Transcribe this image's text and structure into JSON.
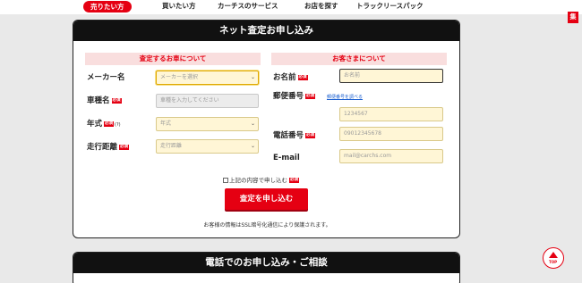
{
  "nav": {
    "items": [
      "売りたい方",
      "買いたい方",
      "カーチスのサービス",
      "お店を探す",
      "トラックリースパック"
    ],
    "side_tab": "集"
  },
  "form": {
    "title": "ネット査定お申し込み",
    "car_section": "査定するお車について",
    "customer_section": "お客さまについて",
    "required_badge": "必須",
    "maker": {
      "label": "メーカー名",
      "placeholder": "メーカーを選択"
    },
    "model": {
      "label": "車種名",
      "placeholder": "車種を入力してください"
    },
    "year": {
      "label": "年式",
      "note": "(?)",
      "placeholder": "年式"
    },
    "mileage": {
      "label": "走行距離",
      "placeholder": "走行距離"
    },
    "name": {
      "label": "お名前",
      "placeholder": "お名前"
    },
    "postal": {
      "label": "郵便番号",
      "lookup_link": "郵便番号を調べる",
      "placeholder": "1234567"
    },
    "phone": {
      "label": "電話番号",
      "placeholder": "09012345678"
    },
    "email": {
      "label": "E-mail",
      "placeholder": "mail@carchs.com"
    },
    "agree_text": "上記の内容で申し込む",
    "submit": "査定を申し込む",
    "ssl_note": "お客様の情報はSSL暗号化通信により保護されます。"
  },
  "phone_section": {
    "title": "電話でのお申し込み・ご相談"
  },
  "top_button": {
    "label": "TOP"
  },
  "colors": {
    "accent": "#e50012",
    "header_bg": "#111111",
    "field_bg": "#fff6d6",
    "section_bg": "#f9dede"
  },
  "icons": {
    "select_chevron": "chevron-down-icon",
    "top": "arrow-up-icon"
  }
}
